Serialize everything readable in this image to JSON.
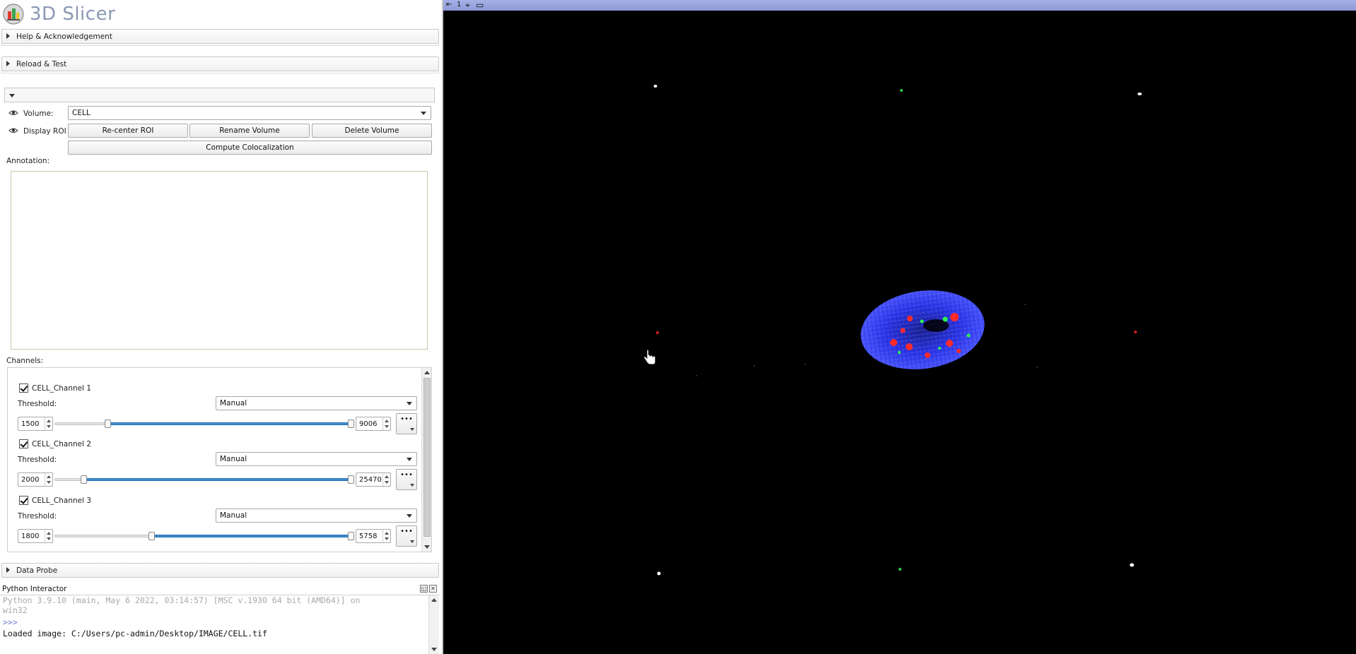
{
  "app": {
    "title": "3D Slicer"
  },
  "sections": {
    "help": "Help & Acknowledgement",
    "reload": "Reload & Test",
    "data_probe": "Data Probe"
  },
  "module": {
    "volume_label": "Volume:",
    "volume_value": "CELL",
    "display_roi_label": "Display ROI",
    "recenter_button": "Re-center ROI",
    "rename_button": "Rename Volume",
    "delete_button": "Delete Volume",
    "compute_button": "Compute Colocalization",
    "annotation_label": "Annotation:",
    "channels_label": "Channels:"
  },
  "channels": [
    {
      "name": "CELL_Channel 1",
      "threshold_label": "Threshold:",
      "threshold_mode": "Manual",
      "min": "1500",
      "max": "9006",
      "low_fraction": 0.17,
      "high_fraction": 1.0,
      "more_label": "•••"
    },
    {
      "name": "CELL_Channel 2",
      "threshold_label": "Threshold:",
      "threshold_mode": "Manual",
      "min": "2000",
      "max": "25470",
      "low_fraction": 0.09,
      "high_fraction": 1.0,
      "more_label": "•••"
    },
    {
      "name": "CELL_Channel 3",
      "threshold_label": "Threshold:",
      "threshold_mode": "Manual",
      "min": "1800",
      "max": "5758",
      "low_fraction": 0.32,
      "high_fraction": 1.0,
      "more_label": "•••"
    }
  ],
  "python": {
    "title": "Python Interactor",
    "line1": "Python 3.9.10 (main, May  6 2022, 03:14:57) [MSC v.1930 64 bit (AMD64)] on",
    "line2": "win32",
    "prompt": ">>>",
    "output": "Loaded image: C:/Users/pc-admin/Desktop/IMAGE/CELL.tif",
    "float_btn": "◱",
    "close_btn": "✕"
  },
  "view": {
    "pin": "⇤",
    "number": "1",
    "crosshair": "⌖",
    "maximize": "▭"
  },
  "colors": {
    "view_bar": "#9aa6e0",
    "nucleus": "#2b35e6",
    "foci_red": "#ff2020",
    "foci_green": "#20ff40",
    "slider_fill": "#3d8fd0",
    "logo_text": "#8a97b4"
  }
}
